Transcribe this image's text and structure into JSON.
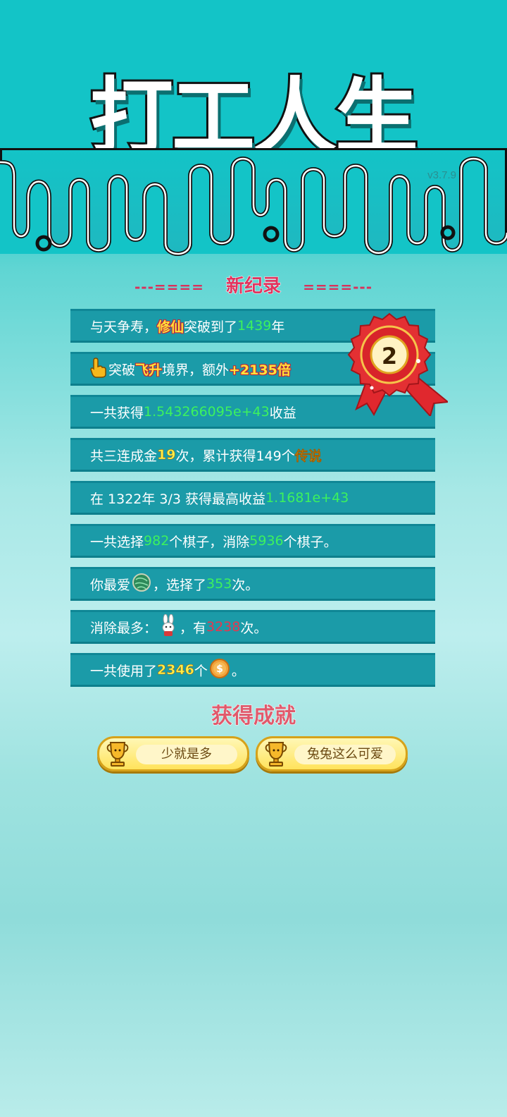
{
  "header": {
    "title": "打工人生",
    "version": "v3.7.9"
  },
  "section": {
    "dash_left": "---====",
    "title": "新纪录",
    "dash_right": "====---"
  },
  "medal": {
    "rank": "2"
  },
  "records": {
    "r1": {
      "a": "与天争寿，",
      "b": "修仙",
      "c": "突破到了",
      "d": "1439",
      "e": "年"
    },
    "r2": {
      "a": "突破",
      "b": "飞升",
      "c": "境界，额外",
      "d": "+2135倍"
    },
    "r3": {
      "a": "一共获得",
      "b": "1.543266095e+43",
      "c": "收益"
    },
    "r4": {
      "a": "共三连成金",
      "b": "19",
      "c": "次，累计获得149个",
      "d": "传说"
    },
    "r5": {
      "a": "在 1322年 3/3 获得最高收益",
      "b": "1.1681e+43"
    },
    "r6": {
      "a": "一共选择",
      "b": "982",
      "c": "个棋子，消除",
      "d": "5936",
      "e": "个棋子。"
    },
    "r7": {
      "a": "你最爱",
      "b": "，选择了",
      "c": "353",
      "d": "次。"
    },
    "r8": {
      "a": "消除最多：",
      "b": "，有",
      "c": "3238",
      "d": "次。"
    },
    "r9": {
      "a": "一共使用了",
      "b": "2346",
      "c": "个",
      "d": "。"
    }
  },
  "achievements": {
    "title": "获得成就",
    "items": [
      {
        "label": "少就是多"
      },
      {
        "label": "兔兔这么可爱"
      }
    ]
  },
  "icons": {
    "hand": "pointing-hand-icon",
    "orb": "green-orb-icon",
    "bunny": "bunny-icon",
    "coin": "coin-icon",
    "trophy": "trophy-icon"
  },
  "colors": {
    "row_bg": "#1b9ba8",
    "highlight_green": "#3df25d",
    "highlight_yellow": "#fff04a",
    "highlight_red": "#e8364e"
  }
}
